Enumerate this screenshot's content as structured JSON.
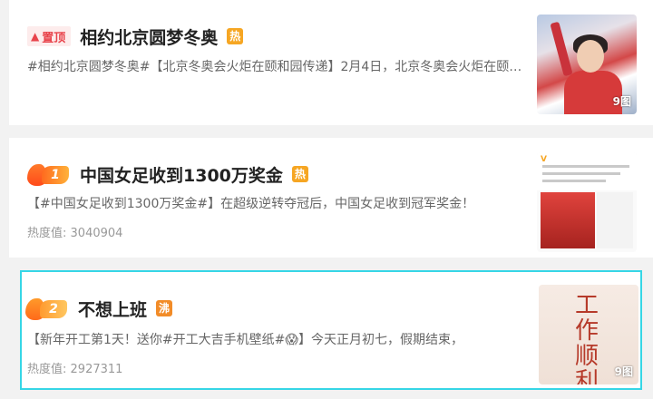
{
  "items": [
    {
      "badge": "置顶",
      "title": "相约北京圆梦冬奥",
      "tag": "热",
      "desc": "#相约北京圆梦冬奥#【北京冬奥会火炬在颐和园传递】2月4日，北京冬奥会火炬在颐和园传递",
      "image_count": "9图"
    },
    {
      "rank": "1",
      "title": "中国女足收到1300万奖金",
      "tag": "热",
      "desc": "【#中国女足收到1300万奖金#】在超级逆转夺冠后，中国女足收到冠军奖金！",
      "heat_label": "热度值:",
      "heat_value": "3040904"
    },
    {
      "rank": "2",
      "title": "不想上班",
      "tag": "沸",
      "desc": "【新年开工第1天！送你#开工大吉手机壁纸#😱】今天正月初七，假期结束，",
      "heat_label": "热度值:",
      "heat_value": "2927311",
      "image_count": "9图",
      "image_text": [
        "工",
        "作",
        "顺",
        "利"
      ]
    }
  ],
  "colors": {
    "accent_red": "#e8434b",
    "tag_orange": "#f6a623",
    "selection": "#36d6e6"
  }
}
